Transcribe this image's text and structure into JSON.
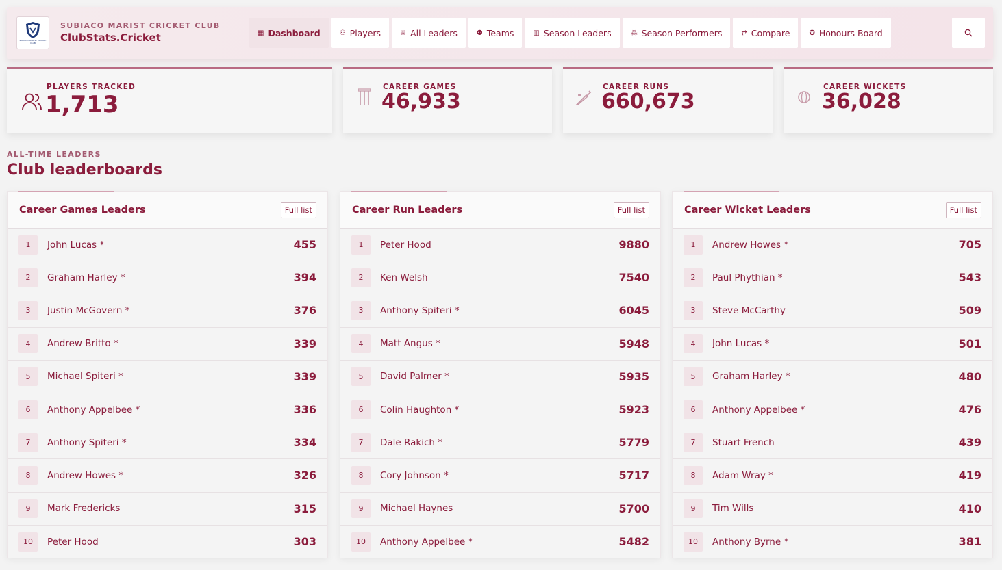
{
  "header": {
    "club_name": "SUBIACO MARIST CRICKET CLUB",
    "brand": "ClubStats.Cricket",
    "logo_text": "SUBIACO MARIST CRICKET CLUB",
    "nav": [
      {
        "label": "Dashboard",
        "icon": "grid-icon"
      },
      {
        "label": "Players",
        "icon": "users-icon"
      },
      {
        "label": "All Leaders",
        "icon": "trophy-icon"
      },
      {
        "label": "Teams",
        "icon": "team-icon"
      },
      {
        "label": "Season Leaders",
        "icon": "bar-chart-icon"
      },
      {
        "label": "Season Performers",
        "icon": "network-icon"
      },
      {
        "label": "Compare",
        "icon": "compare-icon"
      },
      {
        "label": "Honours Board",
        "icon": "award-icon"
      }
    ]
  },
  "stats": [
    {
      "label": "PLAYERS TRACKED",
      "value": "1,713",
      "icon": "users-icon"
    },
    {
      "label": "CAREER GAMES",
      "value": "46,933",
      "icon": "stumps-icon"
    },
    {
      "label": "CAREER RUNS",
      "value": "660,673",
      "icon": "bat-icon"
    },
    {
      "label": "CAREER WICKETS",
      "value": "36,028",
      "icon": "ball-icon"
    }
  ],
  "section": {
    "kicker": "ALL-TIME LEADERS",
    "title": "Club leaderboards"
  },
  "boards": [
    {
      "title": "Career Games Leaders",
      "full_list_label": "Full list",
      "rows": [
        {
          "rank": "1",
          "name": "John Lucas *",
          "value": "455"
        },
        {
          "rank": "2",
          "name": "Graham Harley *",
          "value": "394"
        },
        {
          "rank": "3",
          "name": "Justin McGovern *",
          "value": "376"
        },
        {
          "rank": "4",
          "name": "Andrew Britto *",
          "value": "339"
        },
        {
          "rank": "5",
          "name": "Michael Spiteri *",
          "value": "339"
        },
        {
          "rank": "6",
          "name": "Anthony Appelbee *",
          "value": "336"
        },
        {
          "rank": "7",
          "name": "Anthony Spiteri *",
          "value": "334"
        },
        {
          "rank": "8",
          "name": "Andrew Howes *",
          "value": "326"
        },
        {
          "rank": "9",
          "name": "Mark Fredericks",
          "value": "315"
        },
        {
          "rank": "10",
          "name": "Peter Hood",
          "value": "303"
        }
      ]
    },
    {
      "title": "Career Run Leaders",
      "full_list_label": "Full list",
      "rows": [
        {
          "rank": "1",
          "name": "Peter Hood",
          "value": "9880"
        },
        {
          "rank": "2",
          "name": "Ken Welsh",
          "value": "7540"
        },
        {
          "rank": "3",
          "name": "Anthony Spiteri *",
          "value": "6045"
        },
        {
          "rank": "4",
          "name": "Matt Angus *",
          "value": "5948"
        },
        {
          "rank": "5",
          "name": "David Palmer *",
          "value": "5935"
        },
        {
          "rank": "6",
          "name": "Colin Haughton *",
          "value": "5923"
        },
        {
          "rank": "7",
          "name": "Dale Rakich *",
          "value": "5779"
        },
        {
          "rank": "8",
          "name": "Cory Johnson *",
          "value": "5717"
        },
        {
          "rank": "9",
          "name": "Michael Haynes",
          "value": "5700"
        },
        {
          "rank": "10",
          "name": "Anthony Appelbee *",
          "value": "5482"
        }
      ]
    },
    {
      "title": "Career Wicket Leaders",
      "full_list_label": "Full list",
      "rows": [
        {
          "rank": "1",
          "name": "Andrew Howes *",
          "value": "705"
        },
        {
          "rank": "2",
          "name": "Paul Phythian *",
          "value": "543"
        },
        {
          "rank": "3",
          "name": "Steve McCarthy",
          "value": "509"
        },
        {
          "rank": "4",
          "name": "John Lucas *",
          "value": "501"
        },
        {
          "rank": "5",
          "name": "Graham Harley *",
          "value": "480"
        },
        {
          "rank": "6",
          "name": "Anthony Appelbee *",
          "value": "476"
        },
        {
          "rank": "7",
          "name": "Stuart French",
          "value": "439"
        },
        {
          "rank": "8",
          "name": "Adam Wray *",
          "value": "419"
        },
        {
          "rank": "9",
          "name": "Tim Wills",
          "value": "410"
        },
        {
          "rank": "10",
          "name": "Anthony Byrne *",
          "value": "381"
        }
      ]
    }
  ],
  "colors": {
    "accent": "#8b1c3c",
    "accent_soft": "#f1e3e7"
  }
}
